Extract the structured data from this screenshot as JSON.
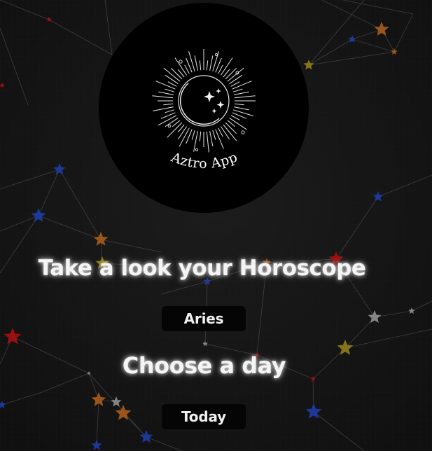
{
  "logo": {
    "app_name": "Aztro App",
    "icon": "crescent-moon-sunburst-icon"
  },
  "headline": "Take a look your Horoscope",
  "sign_select": {
    "value": "Aries"
  },
  "day_prompt": "Choose a day",
  "day_select": {
    "value": "Today"
  },
  "colors": {
    "background": "#141414",
    "logo_circle": "#000000",
    "button_bg": "#050505",
    "text": "#f4f4f4",
    "star_blue": "#1e3a9e",
    "star_orange": "#a0581a",
    "star_red": "#a01010",
    "star_gold": "#8c7a18",
    "star_gray": "#8a8a8a"
  }
}
